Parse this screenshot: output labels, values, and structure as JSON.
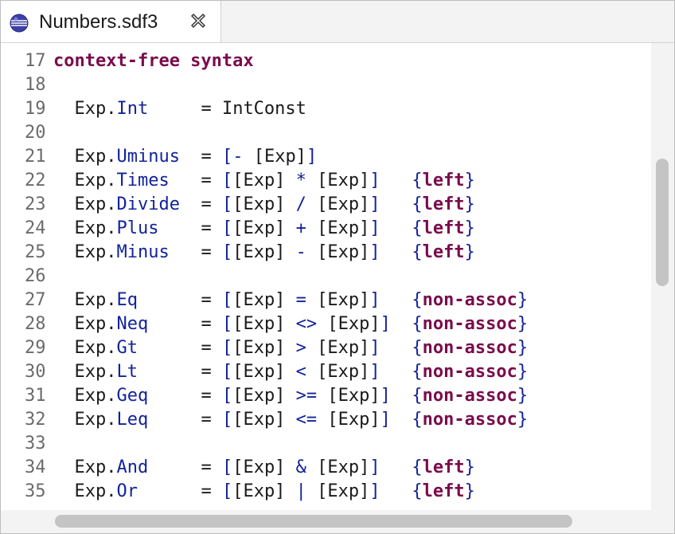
{
  "tab": {
    "title": "Numbers.sdf3",
    "icon": "sdf3-file-icon"
  },
  "lines": [
    {
      "n": "17",
      "parts": [
        {
          "t": "context-free syntax",
          "c": "kw"
        }
      ]
    },
    {
      "n": "18",
      "parts": []
    },
    {
      "n": "19",
      "parts": [
        {
          "t": "  Exp.",
          "c": "sort"
        },
        {
          "t": "Int",
          "c": "cons"
        },
        {
          "t": "     = IntConst",
          "c": "op"
        }
      ]
    },
    {
      "n": "20",
      "parts": []
    },
    {
      "n": "21",
      "parts": [
        {
          "t": "  Exp.",
          "c": "sort"
        },
        {
          "t": "Uminus",
          "c": "cons"
        },
        {
          "t": "  = ",
          "c": "op"
        },
        {
          "t": "[- ",
          "c": "lit"
        },
        {
          "t": "[Exp]",
          "c": "op"
        },
        {
          "t": "]",
          "c": "lit"
        }
      ]
    },
    {
      "n": "22",
      "parts": [
        {
          "t": "  Exp.",
          "c": "sort"
        },
        {
          "t": "Times",
          "c": "cons"
        },
        {
          "t": "   = ",
          "c": "op"
        },
        {
          "t": "[",
          "c": "lit"
        },
        {
          "t": "[Exp]",
          "c": "op"
        },
        {
          "t": " * ",
          "c": "lit"
        },
        {
          "t": "[Exp]",
          "c": "op"
        },
        {
          "t": "]",
          "c": "lit"
        },
        {
          "t": "   ",
          "c": "op"
        },
        {
          "t": "{",
          "c": "brace"
        },
        {
          "t": "left",
          "c": "attr"
        },
        {
          "t": "}",
          "c": "brace"
        }
      ]
    },
    {
      "n": "23",
      "parts": [
        {
          "t": "  Exp.",
          "c": "sort"
        },
        {
          "t": "Divide",
          "c": "cons"
        },
        {
          "t": "  = ",
          "c": "op"
        },
        {
          "t": "[",
          "c": "lit"
        },
        {
          "t": "[Exp]",
          "c": "op"
        },
        {
          "t": " / ",
          "c": "lit"
        },
        {
          "t": "[Exp]",
          "c": "op"
        },
        {
          "t": "]",
          "c": "lit"
        },
        {
          "t": "   ",
          "c": "op"
        },
        {
          "t": "{",
          "c": "brace"
        },
        {
          "t": "left",
          "c": "attr"
        },
        {
          "t": "}",
          "c": "brace"
        }
      ]
    },
    {
      "n": "24",
      "parts": [
        {
          "t": "  Exp.",
          "c": "sort"
        },
        {
          "t": "Plus",
          "c": "cons"
        },
        {
          "t": "    = ",
          "c": "op"
        },
        {
          "t": "[",
          "c": "lit"
        },
        {
          "t": "[Exp]",
          "c": "op"
        },
        {
          "t": " + ",
          "c": "lit"
        },
        {
          "t": "[Exp]",
          "c": "op"
        },
        {
          "t": "]",
          "c": "lit"
        },
        {
          "t": "   ",
          "c": "op"
        },
        {
          "t": "{",
          "c": "brace"
        },
        {
          "t": "left",
          "c": "attr"
        },
        {
          "t": "}",
          "c": "brace"
        }
      ]
    },
    {
      "n": "25",
      "parts": [
        {
          "t": "  Exp.",
          "c": "sort"
        },
        {
          "t": "Minus",
          "c": "cons"
        },
        {
          "t": "   = ",
          "c": "op"
        },
        {
          "t": "[",
          "c": "lit"
        },
        {
          "t": "[Exp]",
          "c": "op"
        },
        {
          "t": " - ",
          "c": "lit"
        },
        {
          "t": "[Exp]",
          "c": "op"
        },
        {
          "t": "]",
          "c": "lit"
        },
        {
          "t": "   ",
          "c": "op"
        },
        {
          "t": "{",
          "c": "brace"
        },
        {
          "t": "left",
          "c": "attr"
        },
        {
          "t": "}",
          "c": "brace"
        }
      ]
    },
    {
      "n": "26",
      "parts": []
    },
    {
      "n": "27",
      "parts": [
        {
          "t": "  Exp.",
          "c": "sort"
        },
        {
          "t": "Eq",
          "c": "cons"
        },
        {
          "t": "      = ",
          "c": "op"
        },
        {
          "t": "[",
          "c": "lit"
        },
        {
          "t": "[Exp]",
          "c": "op"
        },
        {
          "t": " = ",
          "c": "lit"
        },
        {
          "t": "[Exp]",
          "c": "op"
        },
        {
          "t": "]",
          "c": "lit"
        },
        {
          "t": "   ",
          "c": "op"
        },
        {
          "t": "{",
          "c": "brace"
        },
        {
          "t": "non-assoc",
          "c": "attr"
        },
        {
          "t": "}",
          "c": "brace"
        }
      ]
    },
    {
      "n": "28",
      "parts": [
        {
          "t": "  Exp.",
          "c": "sort"
        },
        {
          "t": "Neq",
          "c": "cons"
        },
        {
          "t": "     = ",
          "c": "op"
        },
        {
          "t": "[",
          "c": "lit"
        },
        {
          "t": "[Exp]",
          "c": "op"
        },
        {
          "t": " <> ",
          "c": "lit"
        },
        {
          "t": "[Exp]",
          "c": "op"
        },
        {
          "t": "]",
          "c": "lit"
        },
        {
          "t": "  ",
          "c": "op"
        },
        {
          "t": "{",
          "c": "brace"
        },
        {
          "t": "non-assoc",
          "c": "attr"
        },
        {
          "t": "}",
          "c": "brace"
        }
      ]
    },
    {
      "n": "29",
      "parts": [
        {
          "t": "  Exp.",
          "c": "sort"
        },
        {
          "t": "Gt",
          "c": "cons"
        },
        {
          "t": "      = ",
          "c": "op"
        },
        {
          "t": "[",
          "c": "lit"
        },
        {
          "t": "[Exp]",
          "c": "op"
        },
        {
          "t": " > ",
          "c": "lit"
        },
        {
          "t": "[Exp]",
          "c": "op"
        },
        {
          "t": "]",
          "c": "lit"
        },
        {
          "t": "   ",
          "c": "op"
        },
        {
          "t": "{",
          "c": "brace"
        },
        {
          "t": "non-assoc",
          "c": "attr"
        },
        {
          "t": "}",
          "c": "brace"
        }
      ]
    },
    {
      "n": "30",
      "parts": [
        {
          "t": "  Exp.",
          "c": "sort"
        },
        {
          "t": "Lt",
          "c": "cons"
        },
        {
          "t": "      = ",
          "c": "op"
        },
        {
          "t": "[",
          "c": "lit"
        },
        {
          "t": "[Exp]",
          "c": "op"
        },
        {
          "t": " < ",
          "c": "lit"
        },
        {
          "t": "[Exp]",
          "c": "op"
        },
        {
          "t": "]",
          "c": "lit"
        },
        {
          "t": "   ",
          "c": "op"
        },
        {
          "t": "{",
          "c": "brace"
        },
        {
          "t": "non-assoc",
          "c": "attr"
        },
        {
          "t": "}",
          "c": "brace"
        }
      ]
    },
    {
      "n": "31",
      "parts": [
        {
          "t": "  Exp.",
          "c": "sort"
        },
        {
          "t": "Geq",
          "c": "cons"
        },
        {
          "t": "     = ",
          "c": "op"
        },
        {
          "t": "[",
          "c": "lit"
        },
        {
          "t": "[Exp]",
          "c": "op"
        },
        {
          "t": " >= ",
          "c": "lit"
        },
        {
          "t": "[Exp]",
          "c": "op"
        },
        {
          "t": "]",
          "c": "lit"
        },
        {
          "t": "  ",
          "c": "op"
        },
        {
          "t": "{",
          "c": "brace"
        },
        {
          "t": "non-assoc",
          "c": "attr"
        },
        {
          "t": "}",
          "c": "brace"
        }
      ]
    },
    {
      "n": "32",
      "parts": [
        {
          "t": "  Exp.",
          "c": "sort"
        },
        {
          "t": "Leq",
          "c": "cons"
        },
        {
          "t": "     = ",
          "c": "op"
        },
        {
          "t": "[",
          "c": "lit"
        },
        {
          "t": "[Exp]",
          "c": "op"
        },
        {
          "t": " <= ",
          "c": "lit"
        },
        {
          "t": "[Exp]",
          "c": "op"
        },
        {
          "t": "]",
          "c": "lit"
        },
        {
          "t": "  ",
          "c": "op"
        },
        {
          "t": "{",
          "c": "brace"
        },
        {
          "t": "non-assoc",
          "c": "attr"
        },
        {
          "t": "}",
          "c": "brace"
        }
      ]
    },
    {
      "n": "33",
      "parts": []
    },
    {
      "n": "34",
      "parts": [
        {
          "t": "  Exp.",
          "c": "sort"
        },
        {
          "t": "And",
          "c": "cons"
        },
        {
          "t": "     = ",
          "c": "op"
        },
        {
          "t": "[",
          "c": "lit"
        },
        {
          "t": "[Exp]",
          "c": "op"
        },
        {
          "t": " & ",
          "c": "lit"
        },
        {
          "t": "[Exp]",
          "c": "op"
        },
        {
          "t": "]",
          "c": "lit"
        },
        {
          "t": "   ",
          "c": "op"
        },
        {
          "t": "{",
          "c": "brace"
        },
        {
          "t": "left",
          "c": "attr"
        },
        {
          "t": "}",
          "c": "brace"
        }
      ]
    },
    {
      "n": "35",
      "parts": [
        {
          "t": "  Exp.",
          "c": "sort"
        },
        {
          "t": "Or",
          "c": "cons"
        },
        {
          "t": "      = ",
          "c": "op"
        },
        {
          "t": "[",
          "c": "lit"
        },
        {
          "t": "[Exp]",
          "c": "op"
        },
        {
          "t": " | ",
          "c": "lit"
        },
        {
          "t": "[Exp]",
          "c": "op"
        },
        {
          "t": "]",
          "c": "lit"
        },
        {
          "t": "   ",
          "c": "op"
        },
        {
          "t": "{",
          "c": "brace"
        },
        {
          "t": "left",
          "c": "attr"
        },
        {
          "t": "}",
          "c": "brace"
        }
      ]
    }
  ],
  "colors": {
    "keyword": "#7a0c4c",
    "constructor": "#12239a",
    "line_number": "#6b6b6b",
    "text": "#1a1a1a"
  }
}
